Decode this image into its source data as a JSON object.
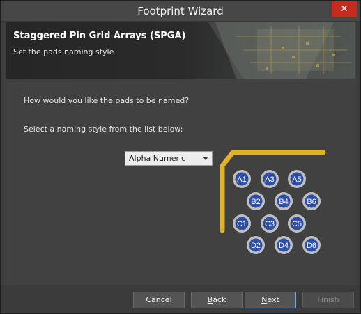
{
  "window": {
    "title": "Footprint Wizard"
  },
  "header": {
    "title": "Staggered Pin Grid Arrays (SPGA)",
    "subtitle": "Set the pads naming style"
  },
  "main": {
    "question": "How would you like the pads to be named?",
    "instruction": "Select a naming style from the list below:",
    "naming_style": {
      "selected": "Alpha Numeric"
    }
  },
  "preview": {
    "pad_labels": [
      "A1",
      "A3",
      "A5",
      "B2",
      "B4",
      "B6",
      "C1",
      "C3",
      "C5",
      "D2",
      "D4",
      "D6"
    ],
    "colors": {
      "outline": "#e0b12a",
      "pad_ring": "#bfbfbf",
      "pad_fill": "#2e4fa8"
    }
  },
  "footer": {
    "cancel": "Cancel",
    "back": "Back",
    "next": "Next",
    "finish": "Finish"
  }
}
